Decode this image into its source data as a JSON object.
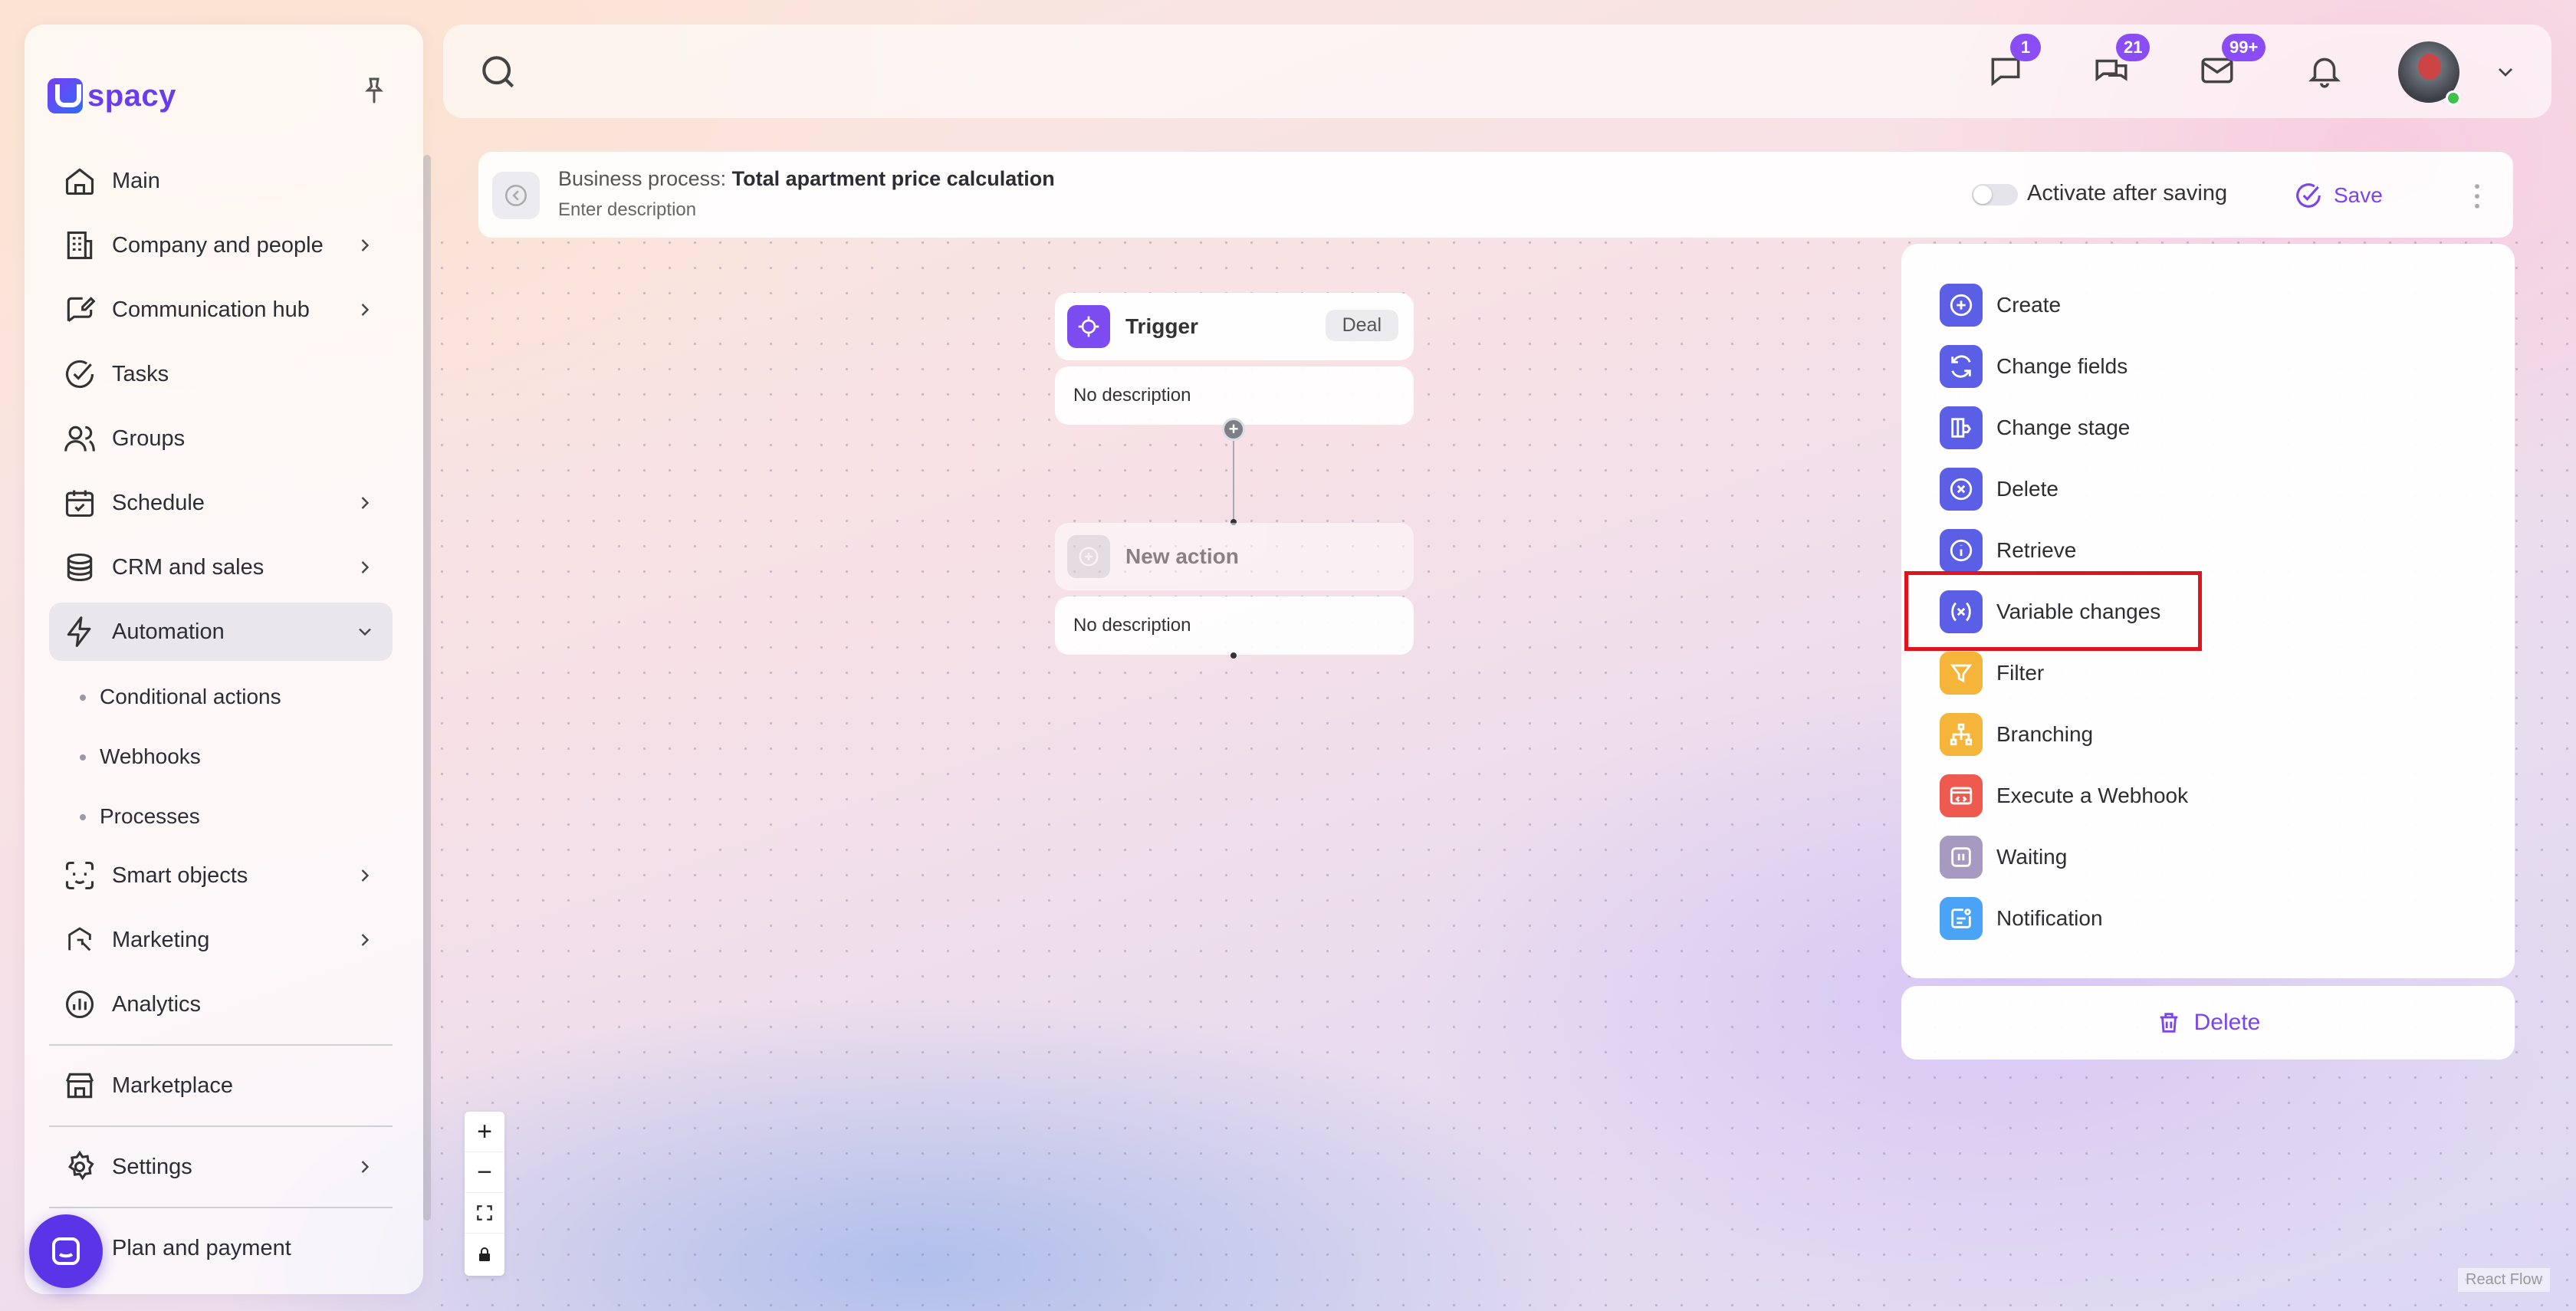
{
  "app": {
    "logo_text": "spacy"
  },
  "sidebar": {
    "items": [
      {
        "label": "Main",
        "icon": "home-icon"
      },
      {
        "label": "Company and people",
        "icon": "building-icon"
      },
      {
        "label": "Communication hub",
        "icon": "chat-edit-icon"
      },
      {
        "label": "Tasks",
        "icon": "check-circle-icon"
      },
      {
        "label": "Groups",
        "icon": "users-icon"
      },
      {
        "label": "Schedule",
        "icon": "calendar-icon"
      },
      {
        "label": "CRM and sales",
        "icon": "coins-icon"
      },
      {
        "label": "Automation",
        "icon": "lightning-icon"
      },
      {
        "label": "Smart objects",
        "icon": "scan-face-icon"
      },
      {
        "label": "Marketing",
        "icon": "marketing-icon"
      },
      {
        "label": "Analytics",
        "icon": "chart-icon"
      },
      {
        "label": "Marketplace",
        "icon": "store-icon"
      },
      {
        "label": "Settings",
        "icon": "gear-icon"
      },
      {
        "label": "Plan and payment",
        "icon": "card-icon"
      }
    ],
    "automation_sub": [
      "Conditional actions",
      "Webhooks",
      "Processes"
    ]
  },
  "header": {
    "badges": {
      "messages": "1",
      "chats": "21",
      "mail": "99+"
    }
  },
  "process": {
    "prefix": "Business process:",
    "title": "Total apartment price calculation",
    "description_placeholder": "Enter description",
    "activate_label": "Activate after saving",
    "activate_on": false,
    "save_label": "Save"
  },
  "flow": {
    "trigger": {
      "title": "Trigger",
      "tag": "Deal",
      "description": "No description"
    },
    "new_action": {
      "title": "New action",
      "description": "No description"
    }
  },
  "actions": [
    {
      "label": "Create",
      "icon": "plus-circle-icon",
      "color": "#5b5fe6"
    },
    {
      "label": "Change fields",
      "icon": "refresh-icon",
      "color": "#5b5fe6"
    },
    {
      "label": "Change stage",
      "icon": "stage-icon",
      "color": "#5b5fe6"
    },
    {
      "label": "Delete",
      "icon": "x-circle-icon",
      "color": "#5b5fe6"
    },
    {
      "label": "Retrieve",
      "icon": "info-icon",
      "color": "#5b5fe6"
    },
    {
      "label": "Variable changes",
      "icon": "variable-icon",
      "color": "#5b5fe6"
    },
    {
      "label": "Filter",
      "icon": "filter-icon",
      "color": "#f5b43a"
    },
    {
      "label": "Branching",
      "icon": "branch-icon",
      "color": "#f5b43a"
    },
    {
      "label": "Execute a Webhook",
      "icon": "webhook-icon",
      "color": "#ef5a4f"
    },
    {
      "label": "Waiting",
      "icon": "pause-icon",
      "color": "#a79ac0"
    },
    {
      "label": "Notification",
      "icon": "notification-icon",
      "color": "#4aa3f5"
    }
  ],
  "delete_label": "Delete",
  "zoom_controls": [
    "+",
    "−"
  ],
  "attribution": "React Flow"
}
